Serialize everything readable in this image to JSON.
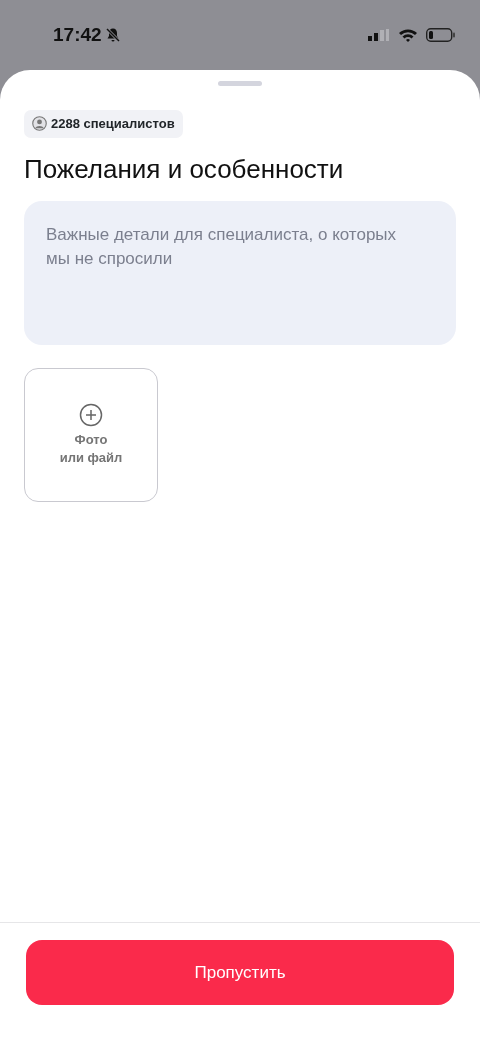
{
  "status_bar": {
    "time": "17:42",
    "silent": true
  },
  "badge": {
    "text": "2288 специалистов"
  },
  "title": "Пожелания и особенности",
  "notes_field": {
    "placeholder": "Важные детали для специалиста, о которых мы не спросили"
  },
  "attach_tile": {
    "label_lines": [
      "Фото",
      "или файл"
    ]
  },
  "skip_button": {
    "label": "Пропустить"
  }
}
